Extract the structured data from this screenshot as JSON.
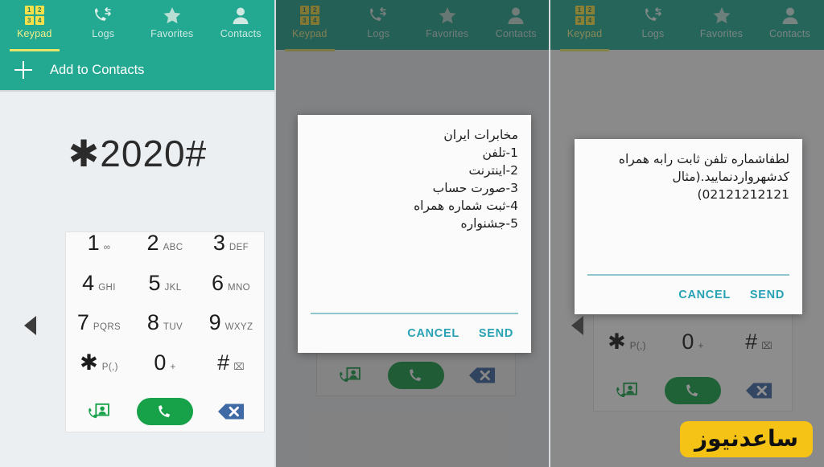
{
  "app": {
    "colors": {
      "teal_header": "#23a891",
      "active_tab_text": "#f2f08a",
      "tab_underline": "#e7e46a",
      "dialog_action": "#27a2b4",
      "call_button_green": "#17a24a",
      "scrim": "#757575",
      "watermark_bg": "#f5c316"
    }
  },
  "tabs": [
    {
      "label": "Keypad",
      "icon": "keypad-grid-icon",
      "active": true
    },
    {
      "label": "Logs",
      "icon": "call-logs-icon",
      "active": false
    },
    {
      "label": "Favorites",
      "icon": "star-icon",
      "active": false
    },
    {
      "label": "Contacts",
      "icon": "person-icon",
      "active": false
    }
  ],
  "keypad_icon_digits": [
    "1",
    "2",
    "3",
    "4"
  ],
  "panel1": {
    "add_to_contacts_label": "Add to Contacts",
    "add_icon": "plus-icon",
    "dialed_number": "✱2020#",
    "back_icon": "back-triangle-icon"
  },
  "panel2": {
    "back_icon": "back-triangle-icon",
    "dialog": {
      "message": "مخابرات ایران\n1-تلفن\n2-اینترنت\n3-صورت حساب\n4-ثبت شماره همراه\n5-جشنواره",
      "input_value": "",
      "input_placeholder": "",
      "cancel_label": "CANCEL",
      "send_label": "SEND"
    }
  },
  "panel3": {
    "back_icon": "back-triangle-icon",
    "dialog": {
      "message": "لطفاشماره تلفن ثابت رابه همراه کدشهرواردنمایید.(مثال 02121212121)",
      "input_value": "",
      "input_placeholder": "",
      "cancel_label": "CANCEL",
      "send_label": "SEND"
    }
  },
  "keypad": {
    "rows": [
      [
        {
          "digit": "1",
          "sub": "∞"
        },
        {
          "digit": "2",
          "sub": "ABC"
        },
        {
          "digit": "3",
          "sub": "DEF"
        }
      ],
      [
        {
          "digit": "4",
          "sub": "GHI"
        },
        {
          "digit": "5",
          "sub": "JKL"
        },
        {
          "digit": "6",
          "sub": "MNO"
        }
      ],
      [
        {
          "digit": "7",
          "sub": "PQRS"
        },
        {
          "digit": "8",
          "sub": "TUV"
        },
        {
          "digit": "9",
          "sub": "WXYZ"
        }
      ],
      [
        {
          "digit": "✱",
          "sub": "P(,)"
        },
        {
          "digit": "0",
          "sub": "+"
        },
        {
          "digit": "#",
          "sub": "⌧"
        }
      ]
    ],
    "actions": {
      "video_call_icon": "video-call-contact-icon",
      "call_icon": "phone-handset-icon",
      "delete_icon": "backspace-delete-icon"
    }
  },
  "watermark": {
    "text": "ساعدنیوز"
  }
}
